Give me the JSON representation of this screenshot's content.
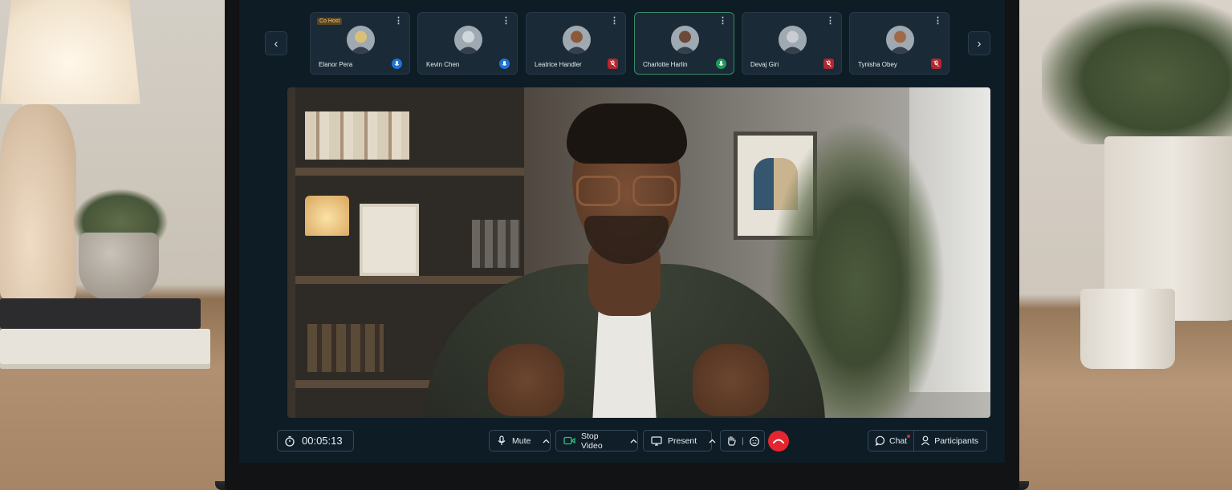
{
  "participants": [
    {
      "name": "Elanor Pera",
      "badge": "Co Host",
      "mic": "on",
      "active": false,
      "avatar_color": "#d9c07a"
    },
    {
      "name": "Kevin Chen",
      "mic": "on",
      "active": false,
      "avatar_color": "#cfd6dc"
    },
    {
      "name": "Leatrice Handler",
      "mic": "muted",
      "active": false,
      "avatar_color": "#8a5a3a"
    },
    {
      "name": "Charlotte Harlin",
      "mic": "speaking",
      "active": true,
      "avatar_color": "#6b4a3a"
    },
    {
      "name": "Devaj Giri",
      "mic": "muted",
      "active": false,
      "avatar_color": "#c9cdd1"
    },
    {
      "name": "Tynisha Obey",
      "mic": "muted",
      "active": false,
      "avatar_color": "#a06a4a"
    }
  ],
  "strip_nav": {
    "prev_icon": "chevron-left-icon",
    "next_icon": "chevron-right-icon"
  },
  "controls": {
    "timer": "00:05:13",
    "mute_label": "Mute",
    "stop_video_label": "Stop Video",
    "present_label": "Present",
    "chat_label": "Chat",
    "participants_label": "Participants",
    "chat_has_unread": true
  },
  "colors": {
    "screen_bg": "#0e1c26",
    "end_call": "#e3262f",
    "mic_on": "#1e74d6",
    "mic_speaking": "#1f9a5a",
    "mic_muted": "#b3262e",
    "active_tile_border": "#3a8a6a"
  }
}
